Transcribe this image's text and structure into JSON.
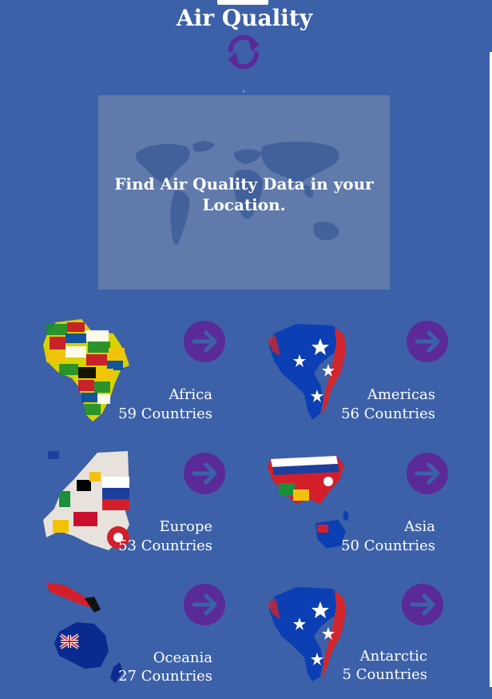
{
  "header": {
    "title": "Air Quality",
    "status_text": "."
  },
  "hero": {
    "text": "Find Air Quality Data in your Location."
  },
  "regions": [
    {
      "name": "Africa",
      "count": "59 Countries"
    },
    {
      "name": "Americas",
      "count": "56 Countries"
    },
    {
      "name": "Europe",
      "count": "53 Countries"
    },
    {
      "name": "Asia",
      "count": "50 Countries"
    },
    {
      "name": "Oceania",
      "count": "27 Countries"
    },
    {
      "name": "Antarctic",
      "count": "5 Countries"
    }
  ],
  "icons": {
    "refresh": "refresh-icon",
    "go": "arrow-right-circle-icon",
    "hero_map": "world-map-icon"
  },
  "colors": {
    "background": "#3c61a8",
    "accent": "#5b2a99",
    "hero_bg": "#5f7aab"
  }
}
